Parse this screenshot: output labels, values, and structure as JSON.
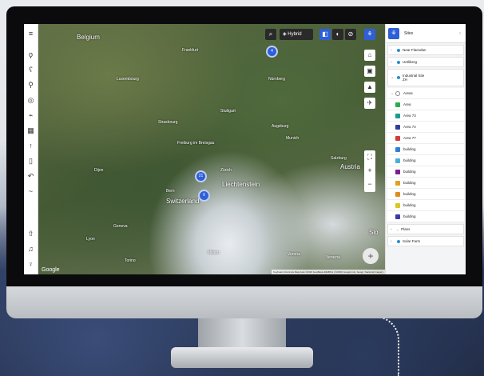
{
  "map": {
    "labels": {
      "belgium": "Belgium",
      "frankfurt": "Frankfurt",
      "nurnberg": "Nürnberg",
      "stuttgart": "Stuttgart",
      "munich": "Munich",
      "salzburg": "Salzburg",
      "austria": "Austria",
      "liechtenstein": "Liechtenstein",
      "switzerland": "Switzerland",
      "bern": "Bern",
      "geneva": "Geneva",
      "lyon": "Lyon",
      "slo": "Slo",
      "strasbourg": "Strasbourg",
      "luxembourg": "Luxembourg",
      "augsburg": "Augsburg",
      "zurich": "Zürich",
      "freiburg": "Freiburg im Breisgau",
      "dijon": "Dijon",
      "venezia": "Venezia",
      "verona": "Verona",
      "milano": "Milano",
      "torino": "Torino",
      "google": "Google"
    },
    "clusters": [
      "4",
      "21",
      "6"
    ],
    "layer_label": "Hybrid",
    "attribution": "Keyboard shortcuts  Map data ©2023 GeoBasis-DE/BKG (©2009) Google Inst. Geogr. Nacional  Imagery"
  },
  "panel": {
    "title": "Sites",
    "sites": [
      {
        "label": "Near Flaesdan"
      },
      {
        "label": "Uetliberg"
      }
    ],
    "industrial": "Industrial Site ZH",
    "areas_group": "Areas",
    "items": [
      {
        "label": "Area",
        "color": "#2eaa4f"
      },
      {
        "label": "Area 73",
        "color": "#1a9d8f"
      },
      {
        "label": "Area 74",
        "color": "#2f3f9a"
      },
      {
        "label": "Area 77",
        "color": "#d43a3a"
      },
      {
        "label": "building",
        "color": "#2f7fd8"
      },
      {
        "label": "building",
        "color": "#4ab0d8"
      },
      {
        "label": "building",
        "color": "#7b1f8f"
      },
      {
        "label": "building",
        "color": "#e0a020"
      },
      {
        "label": "building",
        "color": "#e08a20"
      },
      {
        "label": "building",
        "color": "#d8c820"
      },
      {
        "label": "building",
        "color": "#3a3aa8"
      }
    ],
    "plans": "Plans",
    "solar": "Solar Farm"
  }
}
